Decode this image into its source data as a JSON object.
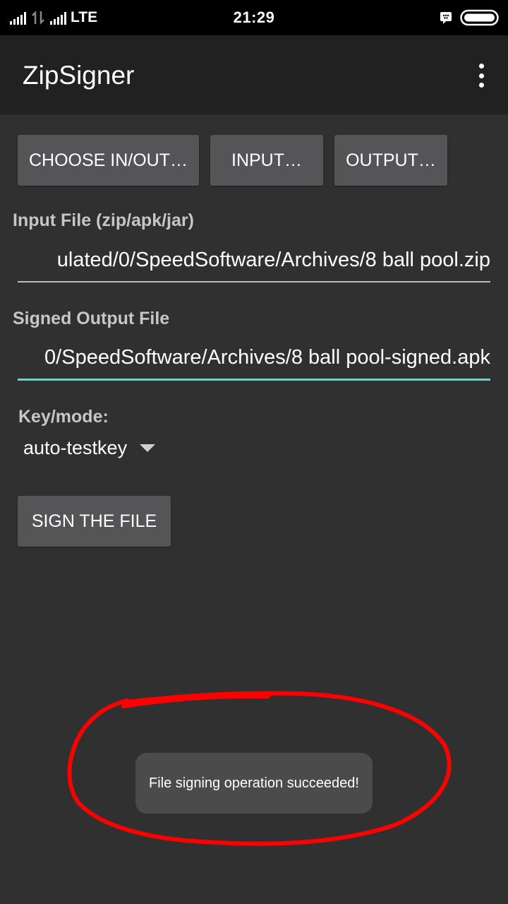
{
  "status_bar": {
    "network": "LTE",
    "time": "21:29"
  },
  "toolbar": {
    "title": "ZipSigner",
    "overflow_icon": "more-vert-icon"
  },
  "buttons": {
    "choose": "CHOOSE IN/OUT…",
    "input": "INPUT…",
    "output": "OUTPUT…",
    "sign": "SIGN THE FILE"
  },
  "input_file": {
    "label": "Input File (zip/apk/jar)",
    "value": "ulated/0/SpeedSoftware/Archives/8 ball pool.zip"
  },
  "output_file": {
    "label": "Signed Output File",
    "value": "0/SpeedSoftware/Archives/8 ball pool-signed.apk"
  },
  "key_mode": {
    "label": "Key/mode:",
    "selected": "auto-testkey"
  },
  "toast": {
    "message": "File signing operation succeeded!"
  },
  "colors": {
    "background": "#303030",
    "toolbar": "#212121",
    "button": "#555557",
    "accent": "#80cbc4",
    "annotation": "#ff0000"
  }
}
